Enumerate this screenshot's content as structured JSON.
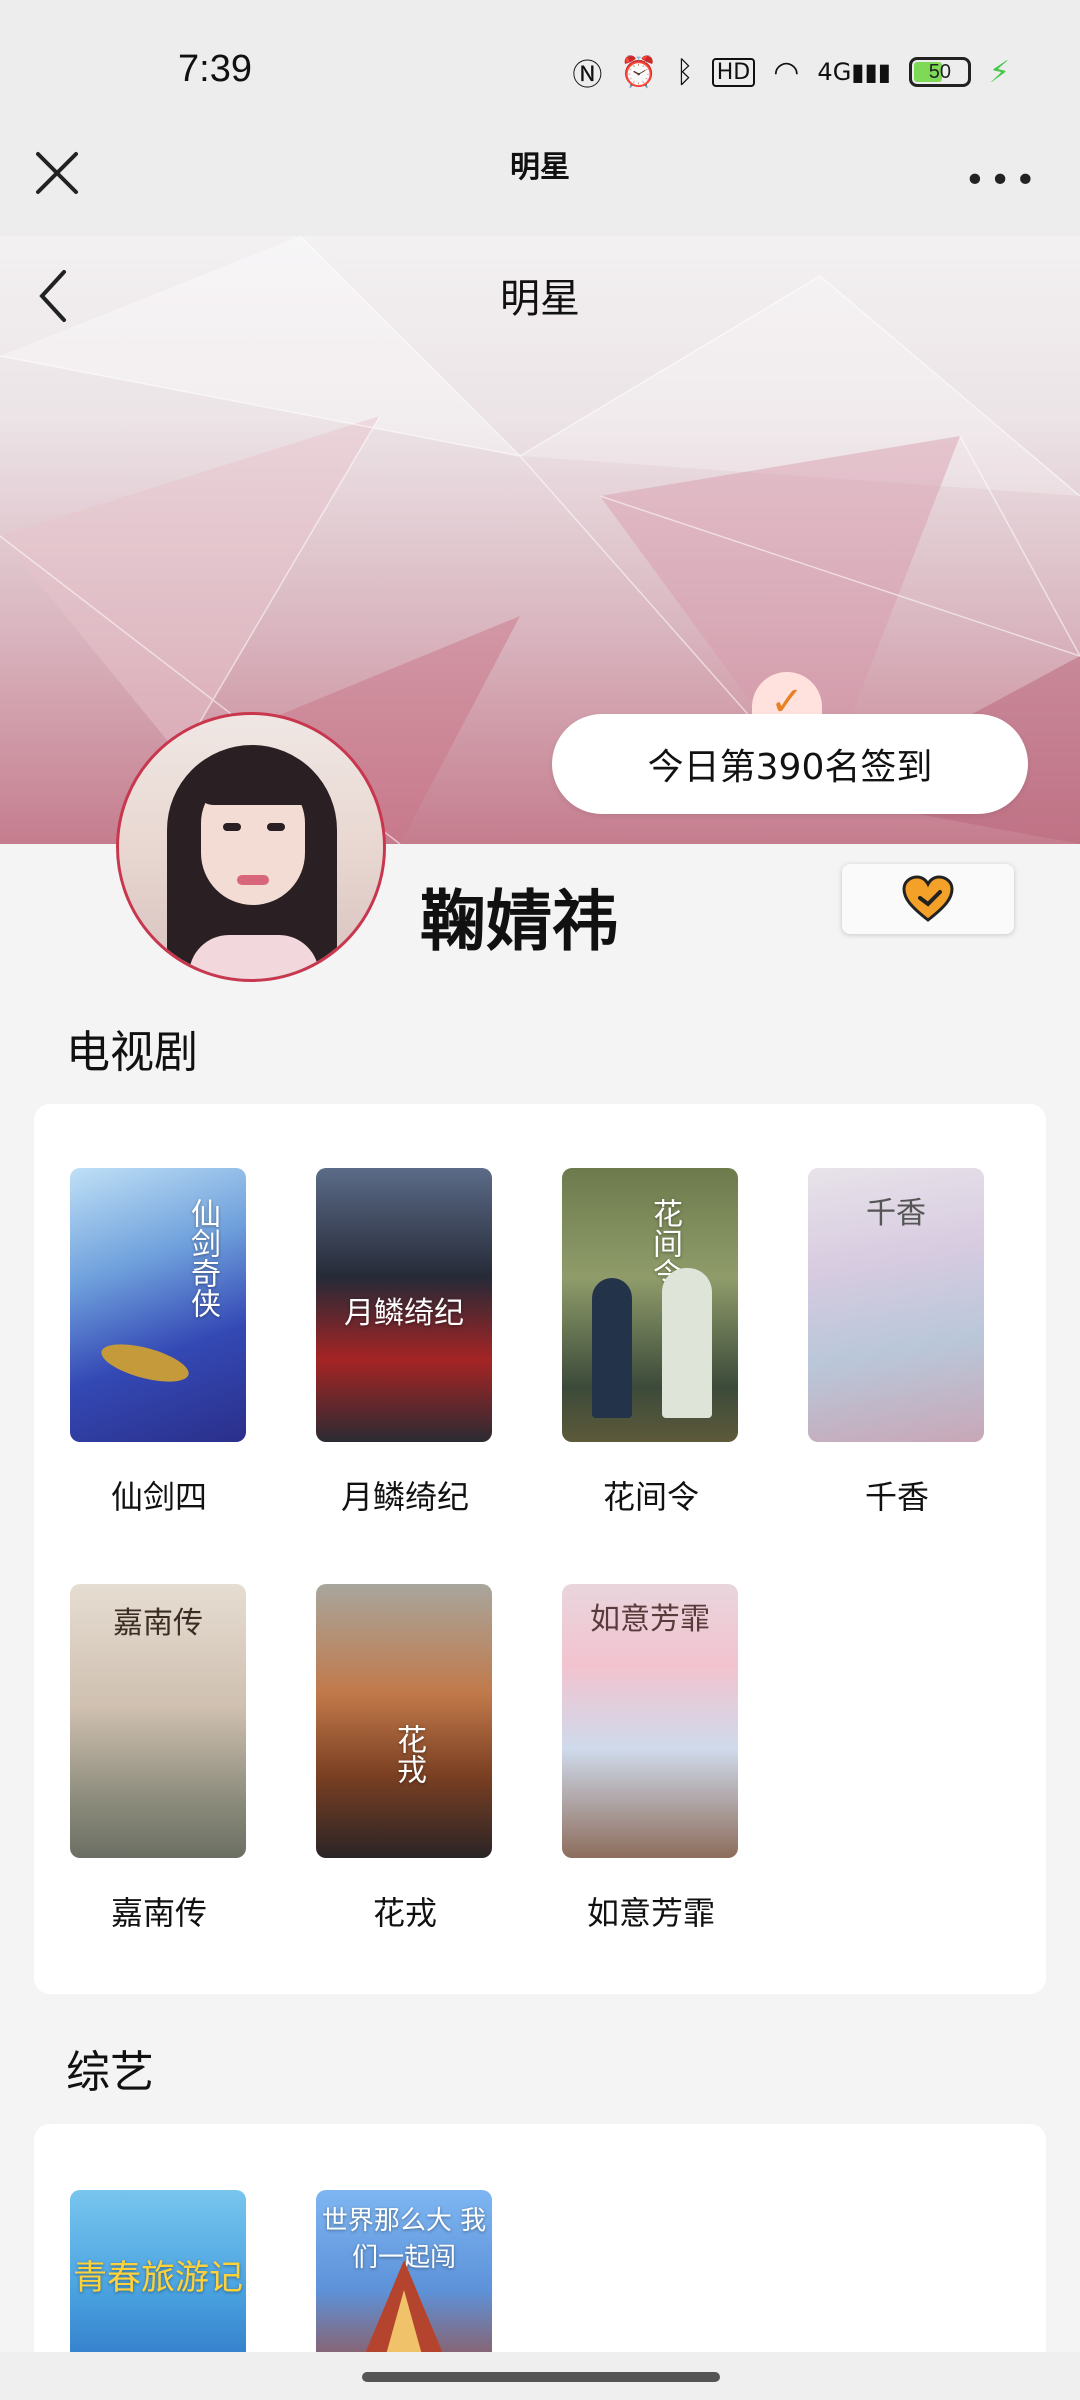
{
  "status_bar": {
    "time": "7:39",
    "icons": [
      "nfc-icon",
      "alarm-icon",
      "bluetooth-icon",
      "hd-icon",
      "wifi-icon",
      "4g-signal-icon"
    ],
    "battery": "50"
  },
  "mini_header": {
    "title": "明星"
  },
  "banner": {
    "page_title": "明星",
    "signin_text": "今日第390名签到"
  },
  "profile": {
    "name": "鞠婧祎"
  },
  "sections": {
    "tv": {
      "title": "电视剧",
      "items": [
        {
          "label": "仙剑四",
          "poster_text": "仙剑奇侠"
        },
        {
          "label": "月鳞绮纪",
          "poster_text": "月鳞绮纪"
        },
        {
          "label": "花间令",
          "poster_text": "花间令"
        },
        {
          "label": "千香",
          "poster_text": "千香"
        },
        {
          "label": "嘉南传",
          "poster_text": "嘉南传"
        },
        {
          "label": "花戎",
          "poster_text": "花戎"
        },
        {
          "label": "如意芳霏",
          "poster_text": "如意芳霏"
        }
      ]
    },
    "variety": {
      "title": "综艺",
      "items": [
        {
          "poster_text": "青春旅游记"
        },
        {
          "poster_text": "世界那么大 我们一起闯"
        }
      ]
    }
  },
  "colors": {
    "accent": "#e88227",
    "avatar_border": "#c9374e",
    "banner_bottom": "#c57d8e"
  }
}
